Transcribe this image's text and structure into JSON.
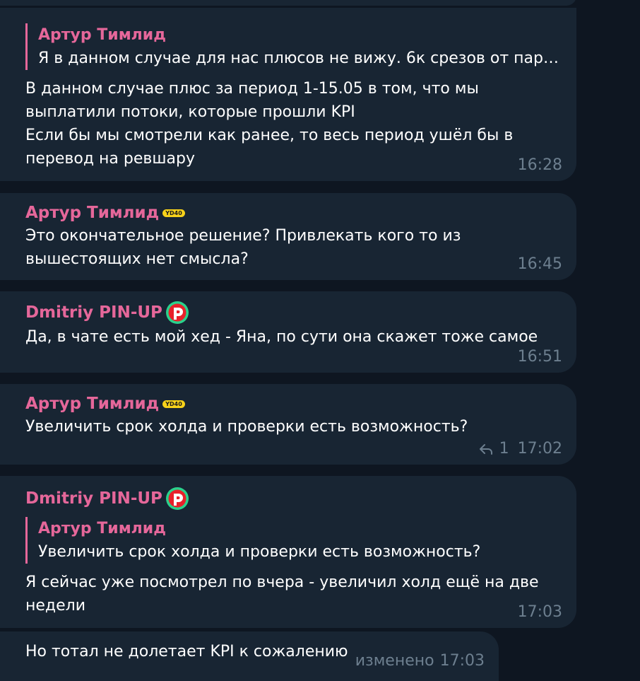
{
  "colors": {
    "background": "#0e1621",
    "bubble": "#182533",
    "sender_name": "#e5679a",
    "message_text": "#ffffff",
    "meta_text": "#6d7f8f",
    "badge_yellow": "#f7d21a",
    "pin_up_green": "#2bd18c",
    "pin_up_red": "#e8202a"
  },
  "icons": {
    "sender_badge_1": "yd-badge-icon",
    "sender_badge_2": "pin-up-logo-icon",
    "reply_count": "reply-arrow-icon"
  },
  "messages": [
    {
      "reply_name": "Артур Тимлид",
      "reply_text": "Я в данном случае для нас плюсов не вижу. 6к срезов от парт...",
      "text": "В данном случае плюс за период 1-15.05 в том, что мы\nвыплатили потоки, которые прошли KPI\nЕсли бы мы смотрели как ранее, то весь период ушёл бы в\nперевод на ревшару",
      "time": "16:28"
    },
    {
      "sender": "Артур Тимлид",
      "badge": "YD40",
      "text": "Это окончательное решение? Привлекать кого то из\nвышестоящих нет смысла?",
      "time": "16:45"
    },
    {
      "sender": "Dmitriy PIN-UP",
      "text": "Да, в чате есть мой хед - Яна, по сути она скажет тоже самое",
      "time": "16:51"
    },
    {
      "sender": "Артур Тимлид",
      "badge": "YD40",
      "text": "Увеличить срок холда и проверки есть возможность?",
      "reply_count": "1",
      "time": "17:02"
    },
    {
      "sender": "Dmitriy PIN-UP",
      "reply_name": "Артур Тимлид",
      "reply_text": "Увеличить срок холда и проверки есть возможность?",
      "text": "Я сейчас уже посмотрел по вчера - увеличил холд ещё на две\nнедели",
      "time": "17:03"
    },
    {
      "text": "Но тотал не долетает KPI к сожалению",
      "edited": "изменено",
      "time": "17:03"
    }
  ]
}
